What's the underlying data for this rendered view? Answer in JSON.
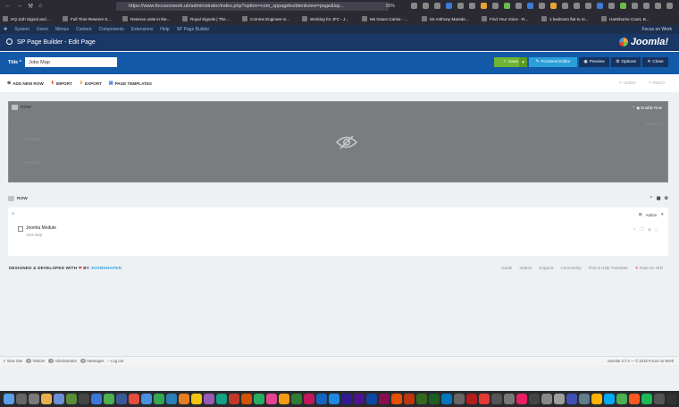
{
  "browser": {
    "url": "https://www.focusonwork.uk/administrator/index.php?option=com_sppagebuilder&view=page&lay...",
    "zoom": "80%",
    "bookmarks": [
      "HQ 11th Signal and ...",
      "Full Time Reserve S...",
      "Reserve units in the...",
      "Royal Signals | The ...",
      "Comms Engineer-S...",
      "Working for JFC - J...",
      "Ms Grace Carins - ...",
      "Mr Anthony Marsde...",
      "Find Your Voice - R...",
      "1 bedroom flat to re...",
      "Hartshorne Court, B..."
    ]
  },
  "admin_menu": {
    "items": [
      "System",
      "Users",
      "Menus",
      "Content",
      "Components",
      "Extensions",
      "Help",
      "SP Page Builder"
    ],
    "site_name": "Focus on Work"
  },
  "header": {
    "title": "SP Page Builder - Edit Page",
    "logo": "Joomla!"
  },
  "toolbar": {
    "title_label": "Title *",
    "title_value": "Jobs Map",
    "save": "Save",
    "frontend_editor": "Frontend Editor",
    "preview": "Preview",
    "options": "Options",
    "close": "Close"
  },
  "actions": {
    "add_new_row": "ADD NEW ROW",
    "import": "IMPORT",
    "export": "EXPORT",
    "page_templates": "PAGE TEMPLATES",
    "undo": "UNDO",
    "redo": "REDO"
  },
  "rows": [
    {
      "label": "ROW",
      "enable": "Enable Row",
      "addon": "Addon",
      "headings": [
        "Heading",
        "Heading"
      ],
      "disabled": true
    },
    {
      "label": "ROW",
      "addon": "Addon",
      "module_title": "Joomla Module",
      "module_sub": "Jobs Map"
    }
  ],
  "footer": {
    "designed": "DESIGNED & DEVELOPED WITH",
    "by": "BY",
    "brand": "JOOMSHAPER",
    "links": [
      "Guide",
      "Videos",
      "Support",
      "Community",
      "Find & Help Translate",
      "Rate on JED"
    ]
  },
  "status": {
    "view_site": "View Site",
    "visitors_count": "0",
    "visitors": "Visitors",
    "admins_count": "1",
    "admins": "Administrator",
    "messages_count": "0",
    "messages": "Messages",
    "logout": "Log out",
    "right": "Joomla! 3.7.3  —  © 2018 Focus on Work"
  },
  "colors": {
    "header": "#1a3867",
    "toolbar": "#135aa8",
    "save": "#6fb433",
    "frontend": "#2b9fd8"
  }
}
